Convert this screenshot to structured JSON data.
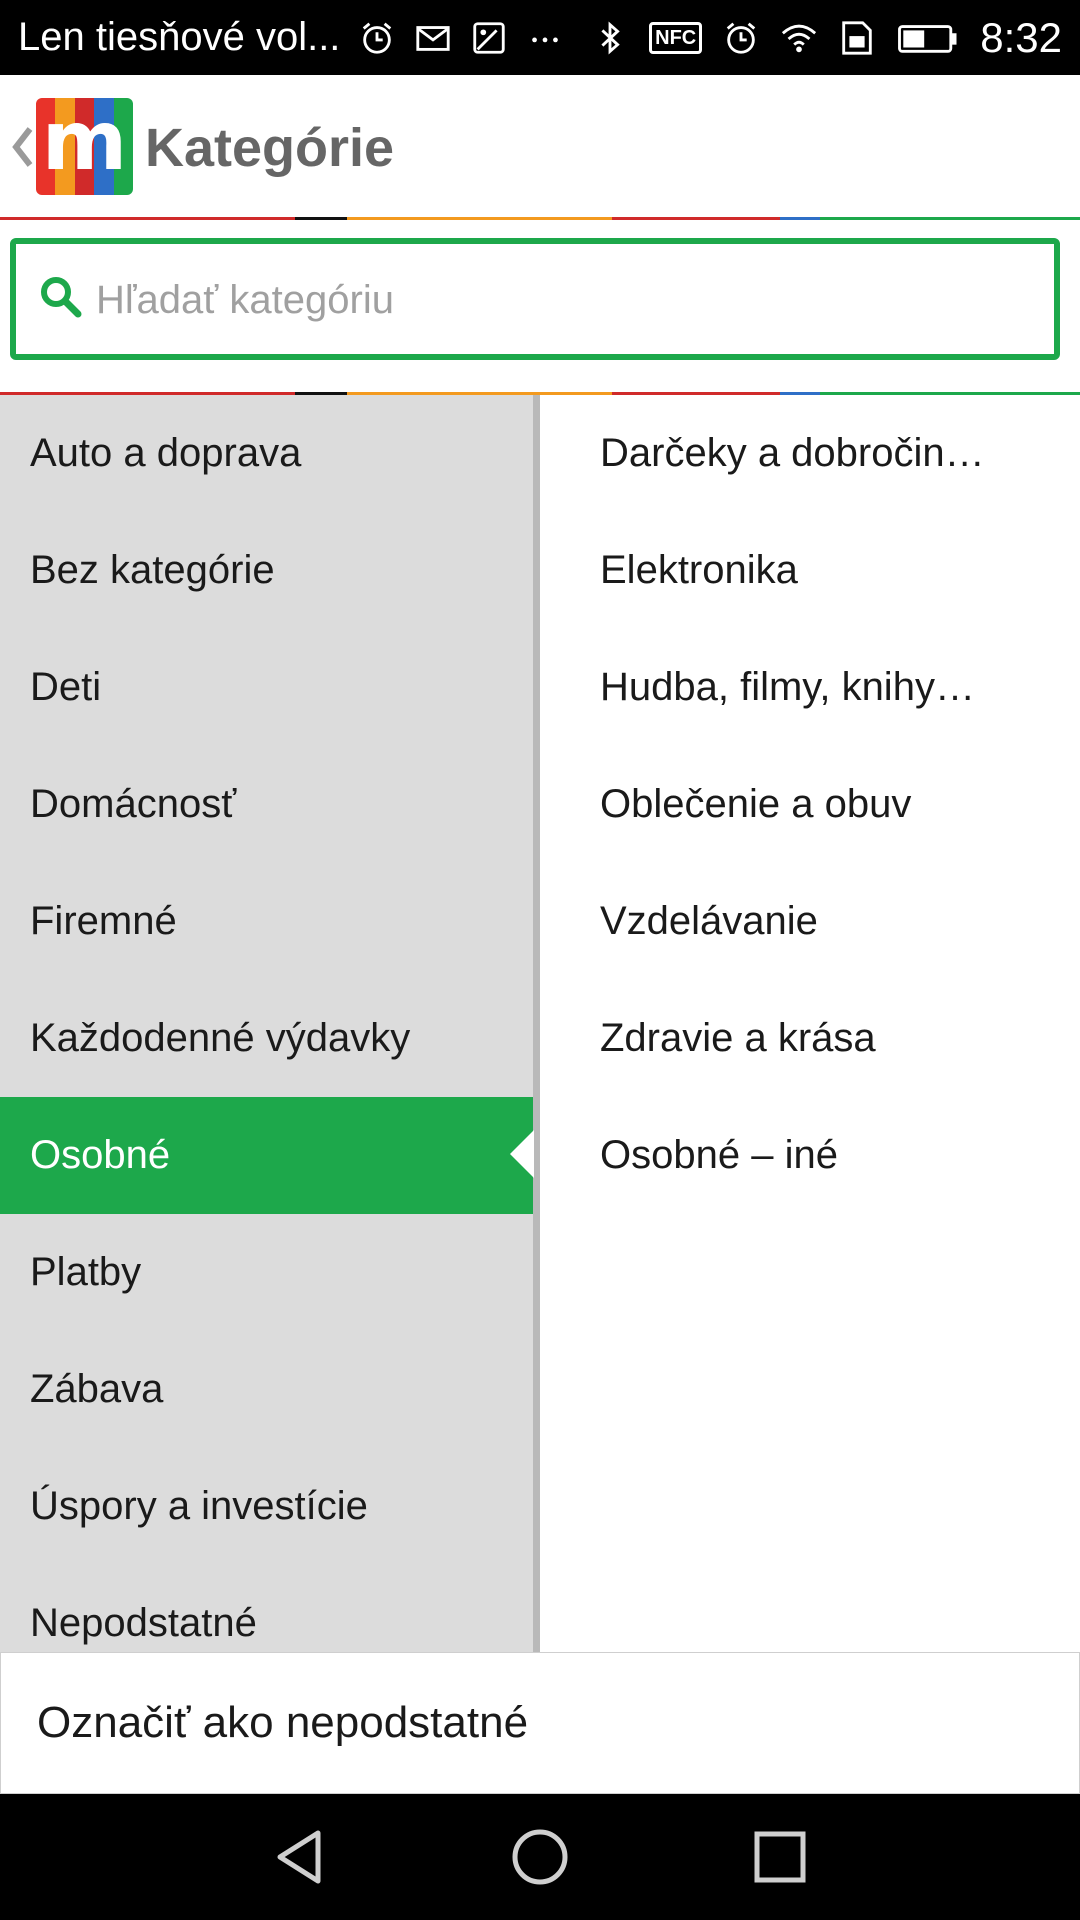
{
  "status_bar": {
    "carrier_text": "Len tiesňové vol...",
    "left_icons": [
      "alarm-icon",
      "mail-icon",
      "gallery-icon",
      "more-icon"
    ],
    "right_icons": [
      "bluetooth-icon",
      "nfc-icon",
      "alarm-icon",
      "wifi-icon",
      "sim-icon",
      "battery-icon"
    ],
    "nfc_label": "NFC",
    "time": "8:32"
  },
  "header": {
    "logo_letter": "m",
    "title": "Kategórie",
    "logo_colors": [
      "#e8332a",
      "#f39a1f",
      "#d02a2a",
      "#2e6fc7",
      "#1da84b"
    ]
  },
  "search": {
    "placeholder": "Hľadať kategóriu",
    "value": ""
  },
  "categories": {
    "left": [
      {
        "label": "Auto a doprava"
      },
      {
        "label": "Bez kategórie"
      },
      {
        "label": "Deti"
      },
      {
        "label": "Domácnosť"
      },
      {
        "label": "Firemné"
      },
      {
        "label": "Každodenné výdavky"
      },
      {
        "label": "Osobné",
        "selected": true
      },
      {
        "label": "Platby"
      },
      {
        "label": "Zábava"
      },
      {
        "label": "Úspory a investície"
      },
      {
        "label": "Nepodstatné"
      }
    ],
    "right": [
      {
        "label": "Darčeky a dobročin…"
      },
      {
        "label": "Elektronika"
      },
      {
        "label": "Hudba, filmy, knihy…"
      },
      {
        "label": "Oblečenie a obuv"
      },
      {
        "label": "Vzdelávanie"
      },
      {
        "label": "Zdravie a krása"
      },
      {
        "label": "Osobné – iné"
      }
    ]
  },
  "bottom_action": {
    "label": "Označiť ako nepodstatné"
  },
  "colors": {
    "accent": "#1da84b",
    "left_bg": "#dcdcdc",
    "title_gray": "#666666"
  },
  "nav_bar": {
    "buttons": [
      "back-icon",
      "home-icon",
      "recents-icon"
    ]
  }
}
